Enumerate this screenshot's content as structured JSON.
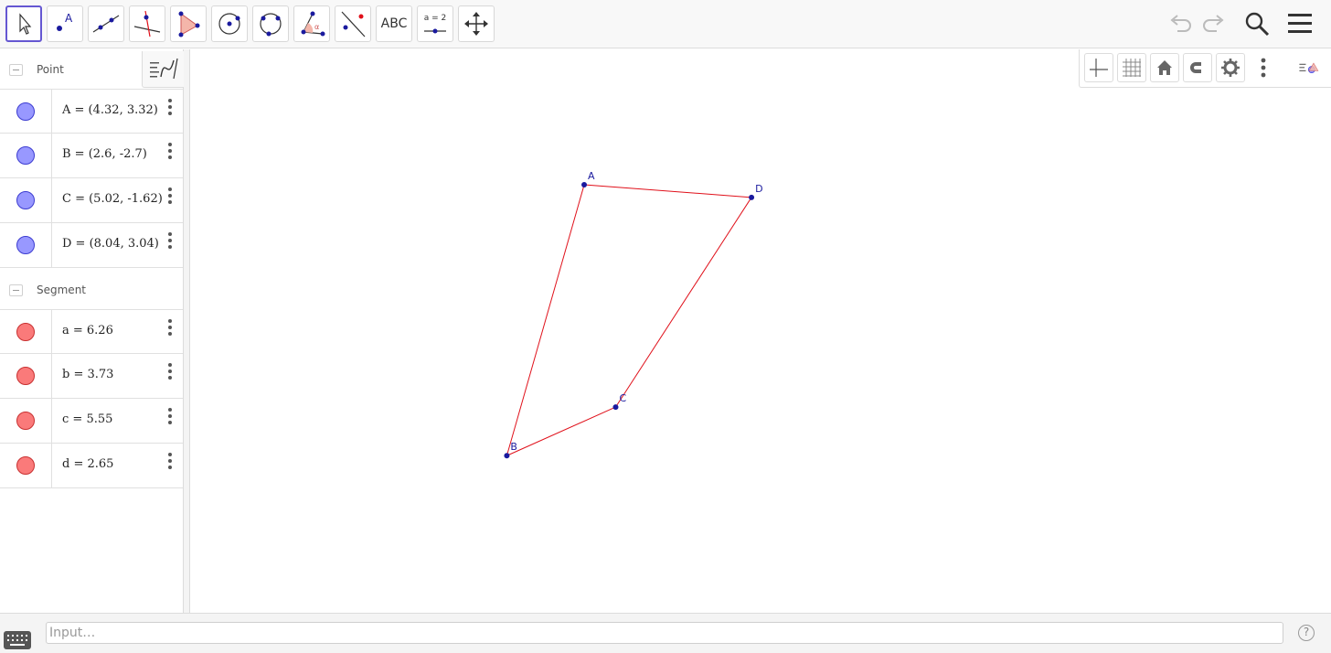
{
  "toolbar": {
    "tools": [
      {
        "name": "move-tool",
        "icon": "arrow-cursor-icon"
      },
      {
        "name": "point-tool",
        "icon": "point-icon",
        "glyph": "A"
      },
      {
        "name": "line-tool",
        "icon": "line-icon"
      },
      {
        "name": "perpendicular-line-tool",
        "icon": "perpendicular-icon"
      },
      {
        "name": "polygon-tool",
        "icon": "triangle-icon"
      },
      {
        "name": "circle-center-point-tool",
        "icon": "circle-icon"
      },
      {
        "name": "circle-three-points-tool",
        "icon": "circle-three-points-icon"
      },
      {
        "name": "angle-tool",
        "icon": "angle-icon",
        "glyph": "α"
      },
      {
        "name": "reflect-tool",
        "icon": "reflect-icon"
      },
      {
        "name": "text-tool",
        "icon": "text-icon",
        "glyph": "ABC"
      },
      {
        "name": "slider-tool",
        "icon": "slider-icon",
        "glyph": "a = 2"
      },
      {
        "name": "move-graphics-tool",
        "icon": "move-arrows-icon"
      }
    ],
    "right": [
      "undo-icon",
      "redo-icon",
      "search-icon",
      "menu-icon"
    ]
  },
  "algebra": {
    "categories": [
      {
        "label": "Point",
        "items": [
          {
            "expr": "A = (4.32, 3.32)",
            "kind": "point",
            "color": "#9898ff"
          },
          {
            "expr": "B = (2.6, -2.7)",
            "kind": "point",
            "color": "#9898ff"
          },
          {
            "expr": "C = (5.02, -1.62)",
            "kind": "point",
            "color": "#9898ff"
          },
          {
            "expr": "D = (8.04, 3.04)",
            "kind": "point",
            "color": "#9898ff"
          }
        ]
      },
      {
        "label": "Segment",
        "items": [
          {
            "expr": "a = 6.26",
            "kind": "segment",
            "color": "#fa7a7a"
          },
          {
            "expr": "b = 3.73",
            "kind": "segment",
            "color": "#fa7a7a"
          },
          {
            "expr": "c = 5.55",
            "kind": "segment",
            "color": "#fa7a7a"
          },
          {
            "expr": "d = 2.65",
            "kind": "segment",
            "color": "#fa7a7a"
          }
        ]
      }
    ]
  },
  "graphics": {
    "toolbar": [
      "axes-icon",
      "grid-icon",
      "home-icon",
      "magnet-icon",
      "gear-icon",
      "more-vertical-icon",
      "style-bar-icon"
    ],
    "points": [
      {
        "label": "A",
        "x": 4.32,
        "y": 3.32
      },
      {
        "label": "B",
        "x": 2.6,
        "y": -2.7
      },
      {
        "label": "C",
        "x": 5.02,
        "y": -1.62
      },
      {
        "label": "D",
        "x": 8.04,
        "y": 3.04
      }
    ],
    "segments": [
      {
        "name": "a",
        "from": "A",
        "to": "B"
      },
      {
        "name": "b",
        "from": "B",
        "to": "C"
      },
      {
        "name": "c",
        "from": "C",
        "to": "D"
      },
      {
        "name": "d",
        "from": "D",
        "to": "A"
      }
    ],
    "colors": {
      "point": "#1a1a9e",
      "segment": "#e0101a",
      "label": "#1a1a9e"
    }
  },
  "input": {
    "placeholder": "Input…"
  },
  "help": {
    "glyph": "?"
  }
}
